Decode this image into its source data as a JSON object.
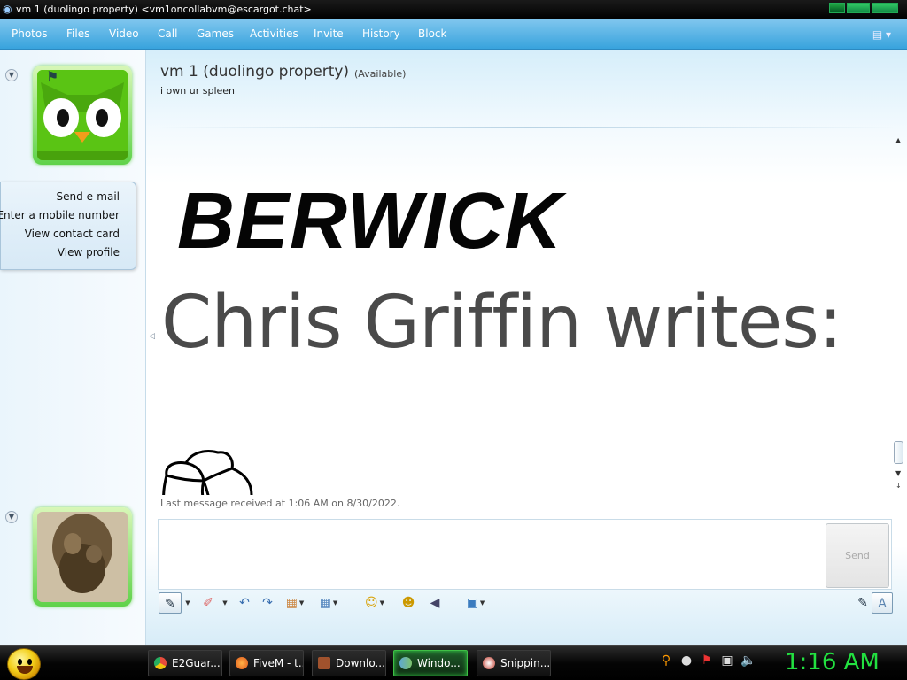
{
  "window": {
    "title": "vm 1 (duolingo property) <vm1oncollabvm@escargot.chat>"
  },
  "menu": {
    "items": [
      "Photos",
      "Files",
      "Video",
      "Call",
      "Games",
      "Activities",
      "Invite",
      "History",
      "Block"
    ]
  },
  "contact": {
    "name": "vm 1 (duolingo property)",
    "status": "(Available)",
    "personal_message": "i own ur spleen",
    "actions": [
      "Send e-mail",
      "Enter a mobile number",
      "View contact card",
      "View profile"
    ]
  },
  "conversation": {
    "heading": "BERWICK",
    "writes_line": "Chris Griffin writes:",
    "last_message": "Last message received at 1:06 AM on 8/30/2022."
  },
  "input": {
    "send_label": "Send"
  },
  "taskbar": {
    "tasks": [
      {
        "label": "E2Guar...",
        "color": "#e74c3c"
      },
      {
        "label": "FiveM - t...",
        "color": "#f08a24"
      },
      {
        "label": "Downlo...",
        "color": "#a0522d"
      },
      {
        "label": "Windo...",
        "color": "#5fa8d3"
      },
      {
        "label": "Snippin...",
        "color": "#c0392b"
      }
    ],
    "clock": "1:16 AM"
  },
  "colors": {
    "menu_blue": "#38a3dd",
    "avatar_green": "#5fd24a",
    "clock_green": "#22e040"
  }
}
